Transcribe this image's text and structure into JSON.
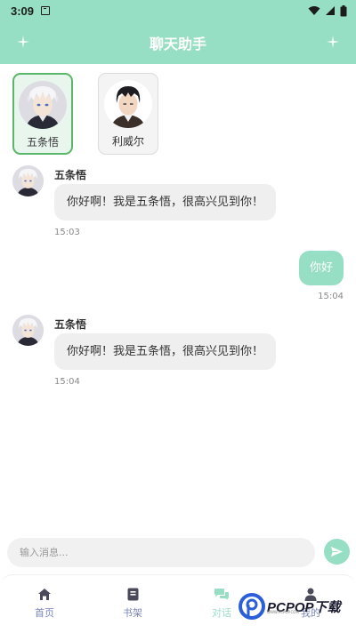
{
  "status_bar": {
    "time": "3:09"
  },
  "header": {
    "title": "聊天助手"
  },
  "characters": [
    {
      "name": "五条悟",
      "selected": true
    },
    {
      "name": "利威尔",
      "selected": false
    }
  ],
  "messages": [
    {
      "sender": "五条悟",
      "text": "你好啊！我是五条悟，很高兴见到你！",
      "time": "15:03"
    },
    {
      "sender": "user",
      "text": "你好",
      "time": "15:04"
    },
    {
      "sender": "五条悟",
      "text": "你好啊！我是五条悟，很高兴见到你！",
      "time": "15:04"
    }
  ],
  "input": {
    "placeholder": "输入消息..."
  },
  "nav": [
    {
      "label": "首页",
      "icon": "home-icon"
    },
    {
      "label": "书架",
      "icon": "bookshelf-icon"
    },
    {
      "label": "对话",
      "icon": "chat-icon",
      "active": true
    },
    {
      "label": "我的",
      "icon": "profile-icon"
    }
  ],
  "watermark": {
    "text": "PCPOP下载",
    "subtext": "WWW.PCPOP.COM"
  },
  "colors": {
    "accent": "#97dfc4",
    "nav_label": "#7a86b8",
    "selected_border": "#5ab76a"
  }
}
